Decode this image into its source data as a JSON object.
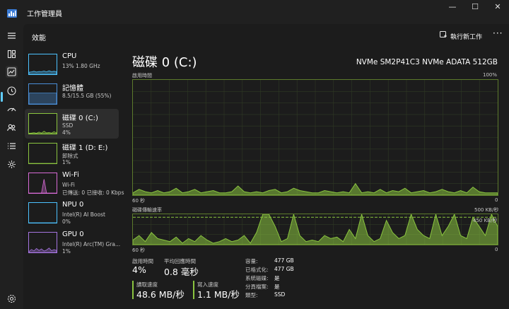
{
  "window": {
    "title": "工作管理員",
    "minimize_glyph": "—",
    "maximize_glyph": "☐",
    "close_glyph": "✕"
  },
  "rail": {
    "icons": [
      "hamburger-menu-icon",
      "processes-icon",
      "performance-icon",
      "app-history-icon",
      "startup-apps-icon",
      "users-icon",
      "details-icon",
      "services-icon",
      "settings-icon"
    ]
  },
  "page": {
    "title": "效能",
    "run_new_task": "執行新工作",
    "more": "···"
  },
  "devices": [
    {
      "name": "CPU",
      "sub1": "13% 1.80 GHz",
      "sub2": "",
      "color": "#4cc2ff",
      "values": [
        0.1,
        0.12,
        0.15,
        0.11,
        0.14,
        0.13,
        0.16,
        0.12,
        0.18,
        0.13,
        0.15,
        0.13
      ]
    },
    {
      "name": "記憶體",
      "sub1": "8.5/15.5 GB (55%)",
      "sub2": "",
      "color": "#4a8fd8",
      "values": [
        0.55,
        0.55,
        0.55,
        0.55,
        0.55,
        0.55,
        0.55,
        0.55,
        0.55,
        0.55,
        0.55,
        0.55
      ]
    },
    {
      "name": "磁碟 0 (C:)",
      "sub1": "SSD",
      "sub2": "4%",
      "color": "#8ac43f",
      "values": [
        0.02,
        0.03,
        0.05,
        0.02,
        0.08,
        0.03,
        0.12,
        0.04,
        0.06,
        0.03,
        0.1,
        0.04
      ]
    },
    {
      "name": "磁碟 1 (D: E:)",
      "sub1": "卸除式",
      "sub2": "1%",
      "color": "#8ac43f",
      "values": [
        0,
        0,
        0,
        0,
        0,
        0,
        0,
        0,
        0,
        0,
        0,
        0
      ]
    },
    {
      "name": "Wi-Fi",
      "sub1": "Wi-Fi",
      "sub2": "已傳送: 0 已接收: 0 Kbps",
      "color": "#d76ad6",
      "values": [
        0,
        0,
        0,
        0,
        0,
        0,
        0.7,
        0,
        0,
        0,
        0,
        0
      ]
    },
    {
      "name": "NPU 0",
      "sub1": "Intel(R) AI Boost",
      "sub2": "0%",
      "color": "#4cc2ff",
      "values": [
        0,
        0,
        0,
        0,
        0,
        0,
        0,
        0,
        0,
        0,
        0,
        0
      ]
    },
    {
      "name": "GPU 0",
      "sub1": "Intel(R) Arc(TM) Gra...",
      "sub2": "1%",
      "color": "#a574e0",
      "values": [
        0.05,
        0.15,
        0.08,
        0.2,
        0.1,
        0.18,
        0.07,
        0.12,
        0.22,
        0.09,
        0.14,
        0.1
      ]
    }
  ],
  "selected_device_index": 2,
  "detail": {
    "title": "磁碟 0 (C:)",
    "model": "NVMe SM2P41C3 NVMe ADATA 512GB",
    "graph1": {
      "label_top_left": "啟用時間",
      "label_top_right": "100%",
      "label_bottom_left": "60 秒",
      "label_bottom_right": "0",
      "color": "#8ac43f",
      "values": [
        0.02,
        0.05,
        0.03,
        0.02,
        0.04,
        0.02,
        0.03,
        0.06,
        0.02,
        0.03,
        0.05,
        0.02,
        0.03,
        0.04,
        0.02,
        0.02,
        0.03,
        0.08,
        0.03,
        0.02,
        0.03,
        0.02,
        0.04,
        0.05,
        0.02,
        0.03,
        0.06,
        0.04,
        0.03,
        0.02,
        0.02,
        0.04,
        0.03,
        0.02,
        0.03,
        0.02,
        0.1,
        0.02,
        0.03,
        0.02,
        0.05,
        0.02,
        0.04,
        0.03,
        0.06,
        0.02,
        0.03,
        0.04,
        0.02,
        0.03,
        0.05,
        0.03,
        0.02,
        0.04,
        0.02,
        0.07,
        0.03,
        0.02,
        0.02,
        0.02
      ]
    },
    "graph2": {
      "label_top_left": "磁碟傳輸速率",
      "label_top_right": "500 KB/秒",
      "ref_line_label": "450 KB/秒",
      "ref_line_value": 0.9,
      "label_bottom_left": "60 秒",
      "label_bottom_right": "0",
      "color": "#8ac43f",
      "values": [
        0.15,
        0.3,
        0.1,
        0.4,
        0.2,
        0.15,
        0.1,
        0.25,
        0.05,
        0.2,
        0.1,
        0.3,
        0.15,
        0.05,
        0.1,
        0.2,
        0.1,
        0.15,
        0.3,
        0.05,
        0.4,
        1.0,
        1.0,
        0.6,
        0.1,
        0.2,
        1.0,
        0.3,
        0.1,
        0.15,
        0.1,
        0.3,
        0.2,
        0.25,
        0.1,
        0.5,
        0.2,
        1.0,
        0.3,
        0.1,
        0.2,
        0.8,
        0.4,
        0.2,
        0.3,
        1.0,
        0.5,
        0.3,
        0.2,
        1.0,
        0.3,
        0.6,
        1.0,
        0.3,
        0.2,
        0.9,
        0.6,
        0.3,
        1.0,
        0.6
      ]
    },
    "stats": {
      "active_time_label": "啟用時間",
      "active_time_value": "4%",
      "avg_response_label": "平均回應時間",
      "avg_response_value": "0.8 毫秒",
      "read_speed_label": "讀取速度",
      "read_speed_value": "48.6 MB/秒",
      "write_speed_label": "寫入速度",
      "write_speed_value": "1.1 MB/秒",
      "read_color": "#8ac43f",
      "write_color": "#8ac43f"
    },
    "props": [
      {
        "label": "容量:",
        "value": "477 GB"
      },
      {
        "label": "已格式化:",
        "value": "477 GB"
      },
      {
        "label": "系統磁碟:",
        "value": "是"
      },
      {
        "label": "分頁檔案:",
        "value": "是"
      },
      {
        "label": "類型:",
        "value": "SSD"
      }
    ]
  }
}
